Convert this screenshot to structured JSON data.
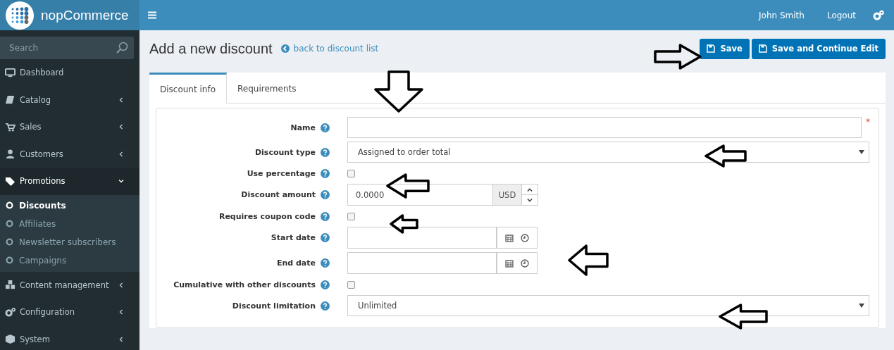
{
  "brand": "nopCommerce",
  "header": {
    "user": "John Smith",
    "logout": "Logout"
  },
  "sidebar": {
    "search_placeholder": "Search",
    "items": [
      {
        "label": "Dashboard",
        "kind": "link"
      },
      {
        "label": "Catalog",
        "kind": "group",
        "expanded": false
      },
      {
        "label": "Sales",
        "kind": "group",
        "expanded": false
      },
      {
        "label": "Customers",
        "kind": "group",
        "expanded": false
      },
      {
        "label": "Promotions",
        "kind": "group",
        "expanded": true,
        "children": [
          {
            "label": "Discounts",
            "selected": true
          },
          {
            "label": "Affiliates",
            "selected": false
          },
          {
            "label": "Newsletter subscribers",
            "selected": false
          },
          {
            "label": "Campaigns",
            "selected": false
          }
        ]
      },
      {
        "label": "Content management",
        "kind": "group",
        "expanded": false
      },
      {
        "label": "Configuration",
        "kind": "group",
        "expanded": false
      },
      {
        "label": "System",
        "kind": "group",
        "expanded": false
      }
    ]
  },
  "page": {
    "title": "Add a new discount",
    "back_link": "back to discount list",
    "buttons": [
      "Save",
      "Save and Continue Edit"
    ]
  },
  "tabs": [
    {
      "label": "Discount info",
      "selected": true
    },
    {
      "label": "Requirements",
      "selected": false
    }
  ],
  "form": [
    {
      "kind": "text",
      "label": "Name",
      "required_mark": "*"
    },
    {
      "kind": "select",
      "label": "Discount type",
      "value": "Assigned to order total"
    },
    {
      "kind": "checkbox",
      "label": "Use percentage",
      "checked": false
    },
    {
      "kind": "number",
      "label": "Discount amount",
      "value": "0.0000",
      "unit": "USD"
    },
    {
      "kind": "checkbox",
      "label": "Requires coupon code",
      "checked": false
    },
    {
      "kind": "date",
      "label": "Start date"
    },
    {
      "kind": "date",
      "label": "End date"
    },
    {
      "kind": "checkbox",
      "label": "Cumulative with other discounts",
      "checked": false
    },
    {
      "kind": "select",
      "label": "Discount limitation",
      "value": "Unlimited"
    }
  ],
  "annotations": [
    {
      "kind": "right"
    },
    {
      "kind": "down"
    },
    {
      "kind": "left"
    },
    {
      "kind": "left"
    },
    {
      "kind": "left"
    },
    {
      "kind": "left"
    },
    {
      "kind": "left"
    }
  ]
}
